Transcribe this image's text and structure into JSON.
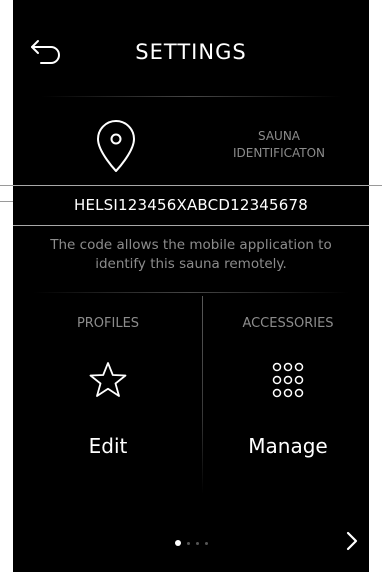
{
  "header": {
    "title": "SETTINGS",
    "back_icon": "back-arrow-icon"
  },
  "identification": {
    "icon": "location-pin-icon",
    "label": "SAUNA\nIDENTIFICATON",
    "label_line1": "SAUNA",
    "label_line2": "IDENTIFICATON",
    "code": "HELSI123456XABCD12345678",
    "description": "The code allows the mobile application to identify this sauna remotely."
  },
  "panels": {
    "profiles": {
      "label": "PROFILES",
      "icon": "star-icon",
      "action": "Edit"
    },
    "accessories": {
      "label": "ACCESSORIES",
      "icon": "dots-grid-icon",
      "action": "Manage"
    }
  },
  "pagination": {
    "total": 4,
    "current": 1,
    "next_icon": "chevron-right-icon"
  },
  "colors": {
    "background": "#000000",
    "text_primary": "#ffffff",
    "text_secondary": "#8c8c8c",
    "divider": "#a8a8a8"
  }
}
